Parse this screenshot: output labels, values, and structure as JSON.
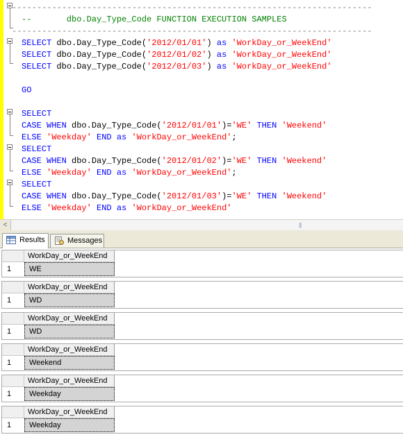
{
  "editor": {
    "lines": [
      {
        "segments": [
          {
            "t": "------------------------------------------------------------------------",
            "c": "gray"
          }
        ]
      },
      {
        "segments": [
          {
            "t": "--       dbo.Day_Type_Code FUNCTION EXECUTION SAMPLES",
            "c": "cmt"
          }
        ]
      },
      {
        "segments": [
          {
            "t": "------------------------------------------------------------------------",
            "c": "gray"
          }
        ]
      },
      {
        "segments": [
          {
            "t": "SELECT ",
            "c": "kw"
          },
          {
            "t": "dbo.Day_Type_Code(",
            "c": "fn"
          },
          {
            "t": "'2012/01/01'",
            "c": "str"
          },
          {
            "t": ") ",
            "c": "fn"
          },
          {
            "t": "as ",
            "c": "kw"
          },
          {
            "t": "'WorkDay_or_WeekEnd'",
            "c": "str"
          }
        ]
      },
      {
        "segments": [
          {
            "t": "SELECT ",
            "c": "kw"
          },
          {
            "t": "dbo.Day_Type_Code(",
            "c": "fn"
          },
          {
            "t": "'2012/01/02'",
            "c": "str"
          },
          {
            "t": ") ",
            "c": "fn"
          },
          {
            "t": "as ",
            "c": "kw"
          },
          {
            "t": "'WorkDay_or_WeekEnd'",
            "c": "str"
          }
        ]
      },
      {
        "segments": [
          {
            "t": "SELECT ",
            "c": "kw"
          },
          {
            "t": "dbo.Day_Type_Code(",
            "c": "fn"
          },
          {
            "t": "'2012/01/03'",
            "c": "str"
          },
          {
            "t": ") ",
            "c": "fn"
          },
          {
            "t": "as ",
            "c": "kw"
          },
          {
            "t": "'WorkDay_or_WeekEnd'",
            "c": "str"
          }
        ]
      },
      {
        "segments": []
      },
      {
        "segments": [
          {
            "t": "GO",
            "c": "kw"
          }
        ]
      },
      {
        "segments": []
      },
      {
        "segments": [
          {
            "t": "SELECT",
            "c": "kw"
          }
        ]
      },
      {
        "segments": [
          {
            "t": "CASE WHEN ",
            "c": "kw"
          },
          {
            "t": "dbo.Day_Type_Code(",
            "c": "fn"
          },
          {
            "t": "'2012/01/01'",
            "c": "str"
          },
          {
            "t": ")=",
            "c": "fn"
          },
          {
            "t": "'WE' ",
            "c": "str"
          },
          {
            "t": "THEN ",
            "c": "kw"
          },
          {
            "t": "'Weekend'",
            "c": "str"
          }
        ]
      },
      {
        "segments": [
          {
            "t": "ELSE ",
            "c": "kw"
          },
          {
            "t": "'Weekday' ",
            "c": "str"
          },
          {
            "t": "END as ",
            "c": "kw"
          },
          {
            "t": "'WorkDay_or_WeekEnd'",
            "c": "str"
          },
          {
            "t": ";",
            "c": "fn"
          }
        ]
      },
      {
        "segments": [
          {
            "t": "SELECT",
            "c": "kw"
          }
        ]
      },
      {
        "segments": [
          {
            "t": "CASE WHEN ",
            "c": "kw"
          },
          {
            "t": "dbo.Day_Type_Code(",
            "c": "fn"
          },
          {
            "t": "'2012/01/02'",
            "c": "str"
          },
          {
            "t": ")=",
            "c": "fn"
          },
          {
            "t": "'WE' ",
            "c": "str"
          },
          {
            "t": "THEN ",
            "c": "kw"
          },
          {
            "t": "'Weekend'",
            "c": "str"
          }
        ]
      },
      {
        "segments": [
          {
            "t": "ELSE ",
            "c": "kw"
          },
          {
            "t": "'Weekday' ",
            "c": "str"
          },
          {
            "t": "END as ",
            "c": "kw"
          },
          {
            "t": "'WorkDay_or_WeekEnd'",
            "c": "str"
          },
          {
            "t": ";",
            "c": "fn"
          }
        ]
      },
      {
        "segments": [
          {
            "t": "SELECT",
            "c": "kw"
          }
        ]
      },
      {
        "segments": [
          {
            "t": "CASE WHEN ",
            "c": "kw"
          },
          {
            "t": "dbo.Day_Type_Code(",
            "c": "fn"
          },
          {
            "t": "'2012/01/03'",
            "c": "str"
          },
          {
            "t": ")=",
            "c": "fn"
          },
          {
            "t": "'WE' ",
            "c": "str"
          },
          {
            "t": "THEN ",
            "c": "kw"
          },
          {
            "t": "'Weekend'",
            "c": "str"
          }
        ]
      },
      {
        "segments": [
          {
            "t": "ELSE ",
            "c": "kw"
          },
          {
            "t": "'Weekday' ",
            "c": "str"
          },
          {
            "t": "END as ",
            "c": "kw"
          },
          {
            "t": "'WorkDay_or_WeekEnd'",
            "c": "str"
          }
        ]
      }
    ]
  },
  "scrollbar": {
    "left_arrow": "<",
    "grip": "|||"
  },
  "tabs": {
    "results_label": "Results",
    "messages_label": "Messages"
  },
  "results": [
    {
      "column": "WorkDay_or_WeekEnd",
      "row_number": "1",
      "value": "WE"
    },
    {
      "column": "WorkDay_or_WeekEnd",
      "row_number": "1",
      "value": "WD"
    },
    {
      "column": "WorkDay_or_WeekEnd",
      "row_number": "1",
      "value": "WD"
    },
    {
      "column": "WorkDay_or_WeekEnd",
      "row_number": "1",
      "value": "Weekend"
    },
    {
      "column": "WorkDay_or_WeekEnd",
      "row_number": "1",
      "value": "Weekday"
    },
    {
      "column": "WorkDay_or_WeekEnd",
      "row_number": "1",
      "value": "Weekday"
    }
  ],
  "colors": {
    "keyword": "#0000ff",
    "string": "#ff0000",
    "comment": "#008000",
    "gutter": "#ffff00"
  }
}
